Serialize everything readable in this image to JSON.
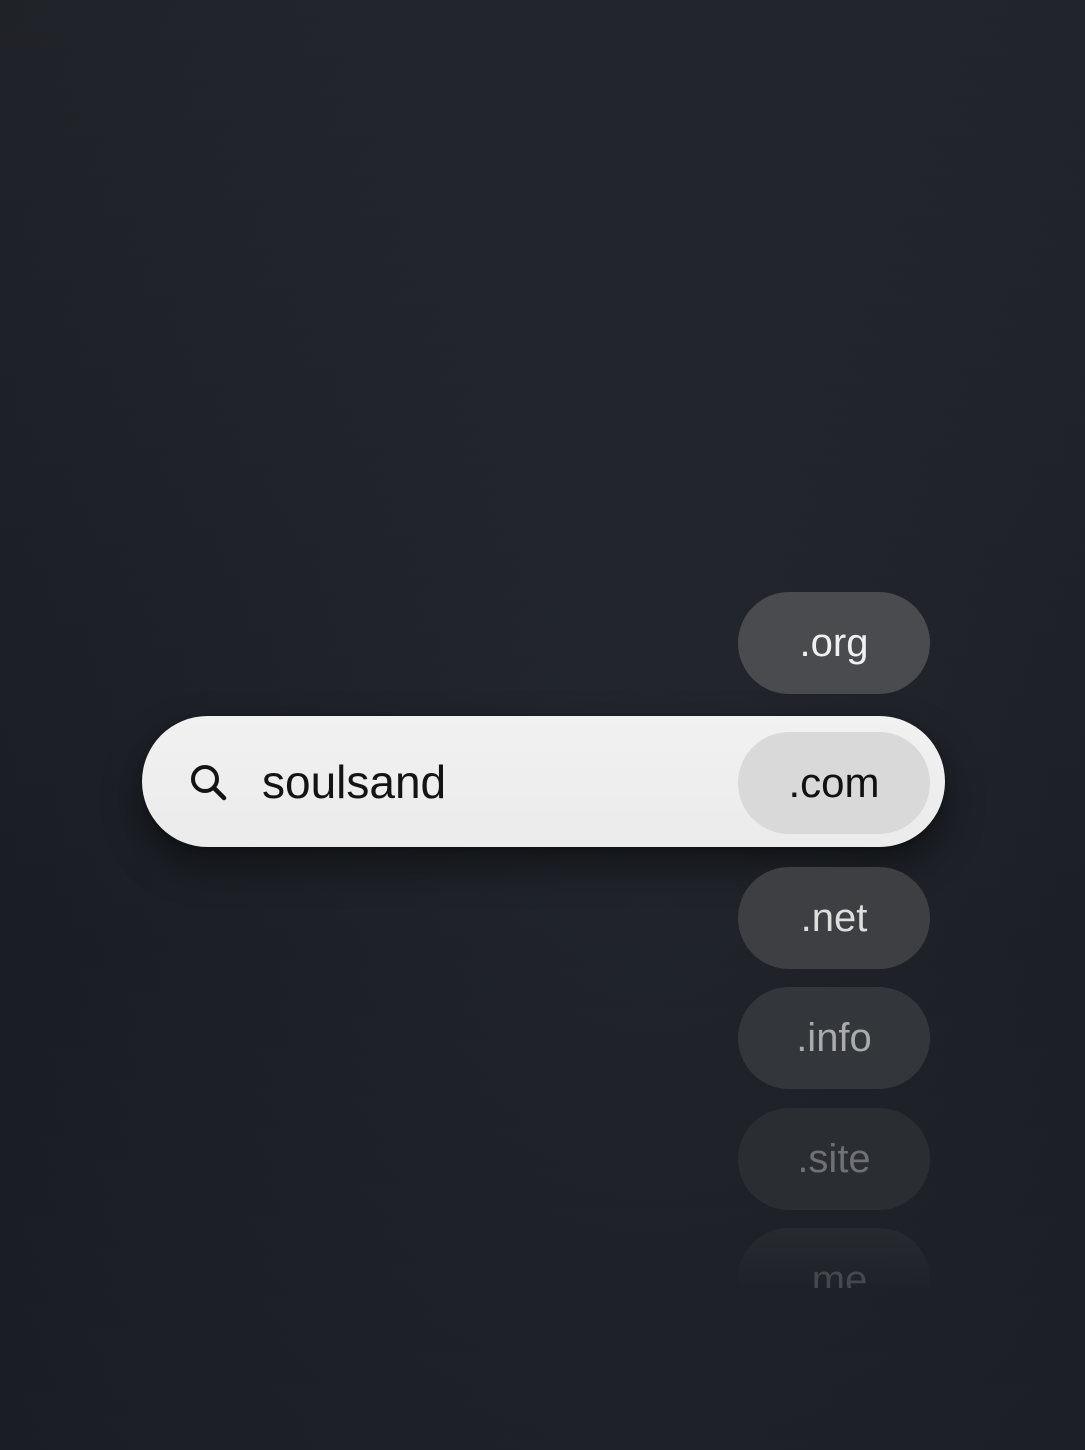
{
  "search": {
    "value": "soulsand",
    "icon": "search-icon"
  },
  "tlds": {
    "selected": ".com",
    "above": [
      ".org"
    ],
    "below": [
      ".net",
      ".info",
      ".site",
      ".me"
    ]
  }
}
